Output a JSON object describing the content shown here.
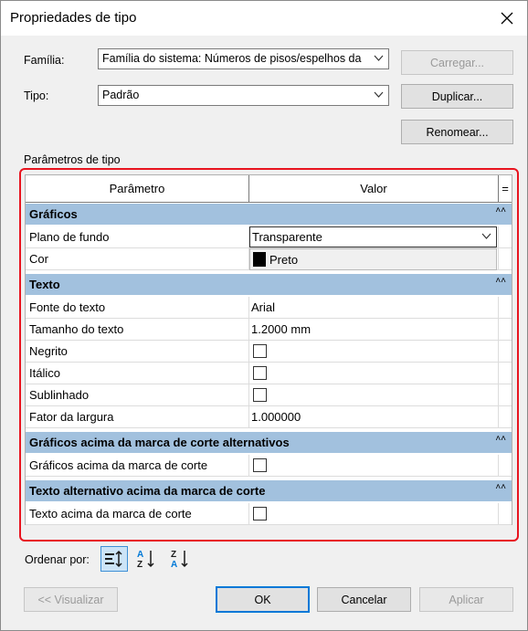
{
  "window": {
    "title": "Propriedades de tipo"
  },
  "family": {
    "label": "Família:",
    "value": "Família do sistema: Números de pisos/espelhos da",
    "load_label": "Carregar..."
  },
  "type": {
    "label": "Tipo:",
    "value": "Padrão",
    "duplicate_label": "Duplicar...",
    "rename_label": "Renomear..."
  },
  "type_params": {
    "section_label": "Parâmetros de tipo",
    "col_param": "Parâmetro",
    "col_value": "Valor",
    "col_eq": "=",
    "groups": [
      {
        "name": "Gráficos",
        "rows": [
          {
            "param": "Plano de fundo",
            "value": "Transparente",
            "kind": "combo"
          },
          {
            "param": "Cor",
            "value": "Preto",
            "kind": "dropdown-item",
            "swatch": "#000000"
          }
        ]
      },
      {
        "name": "Texto",
        "rows": [
          {
            "param": "Fonte do texto",
            "value": "Arial",
            "kind": "text"
          },
          {
            "param": "Tamanho do texto",
            "value": "1.2000 mm",
            "kind": "text"
          },
          {
            "param": "Negrito",
            "value": false,
            "kind": "checkbox"
          },
          {
            "param": "Itálico",
            "value": false,
            "kind": "checkbox"
          },
          {
            "param": "Sublinhado",
            "value": false,
            "kind": "checkbox"
          },
          {
            "param": "Fator da largura",
            "value": "1.000000",
            "kind": "text"
          }
        ]
      },
      {
        "name": "Gráficos acima da marca de corte alternativos",
        "rows": [
          {
            "param": "Gráficos acima da marca de corte",
            "value": false,
            "kind": "checkbox"
          }
        ]
      },
      {
        "name": "Texto alternativo acima da marca de corte",
        "rows": [
          {
            "param": "Texto acima da marca de corte",
            "value": false,
            "kind": "checkbox"
          }
        ]
      }
    ]
  },
  "sort": {
    "label": "Ordenar por:"
  },
  "footer": {
    "preview_label": "<< Visualizar",
    "ok_label": "OK",
    "cancel_label": "Cancelar",
    "apply_label": "Aplicar"
  },
  "colors": {
    "group_bg": "#a2c1de",
    "highlight": "#e8141f",
    "accent": "#0078d7"
  }
}
